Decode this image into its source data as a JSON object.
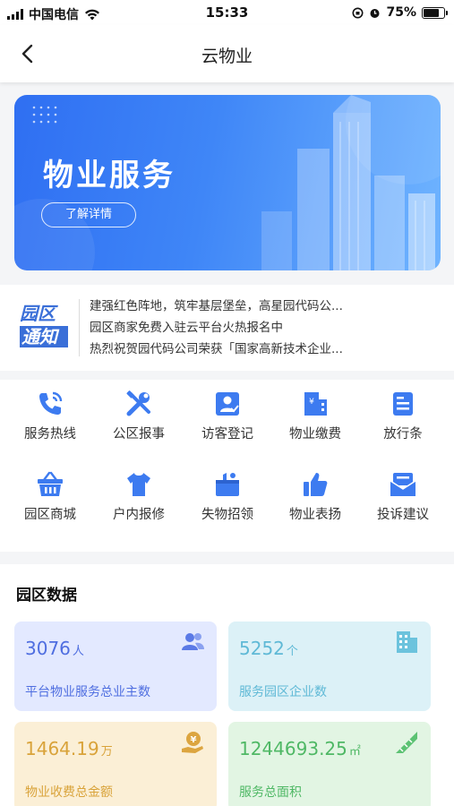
{
  "status_bar": {
    "carrier": "中国电信",
    "time": "15:33",
    "battery": "75%",
    "battery_level": 0.75
  },
  "nav": {
    "title": "云物业",
    "back_icon": "chevron-left-icon"
  },
  "banner": {
    "title": "物业服务",
    "button_label": "了解详情"
  },
  "notice": {
    "logo_line1": "园区",
    "logo_line2": "通知",
    "items": [
      "建强红色阵地，筑牢基层堡垒，高星园代码公...",
      "园区商家免费入驻云平台火热报名中",
      "热烈祝贺园代码公司荣获「国家高新技术企业..."
    ]
  },
  "services": [
    {
      "label": "服务热线",
      "icon": "phone-icon"
    },
    {
      "label": "公区报事",
      "icon": "tools-icon"
    },
    {
      "label": "访客登记",
      "icon": "visitor-icon"
    },
    {
      "label": "物业缴费",
      "icon": "building-fee-icon"
    },
    {
      "label": "放行条",
      "icon": "pass-slip-icon"
    },
    {
      "label": "园区商城",
      "icon": "basket-icon"
    },
    {
      "label": "户内报修",
      "icon": "repair-icon"
    },
    {
      "label": "失物招领",
      "icon": "lost-found-icon"
    },
    {
      "label": "物业表扬",
      "icon": "thumbs-up-icon"
    },
    {
      "label": "投诉建议",
      "icon": "mail-icon"
    }
  ],
  "park_data": {
    "title": "园区数据",
    "cards": [
      {
        "value": "3076",
        "unit": "人",
        "label": "平台物业服务总业主数",
        "icon": "users-icon",
        "bg": "#e3e9ff",
        "color": "#4f6ee0"
      },
      {
        "value": "5252",
        "unit": "个",
        "label": "服务园区企业数",
        "icon": "building-icon",
        "bg": "#dcf1f7",
        "color": "#5fb9d6"
      },
      {
        "value": "1464.19",
        "unit": "万",
        "label": "物业收费总金额",
        "icon": "yuan-hand-icon",
        "bg": "#fbefd6",
        "color": "#d9a33a"
      },
      {
        "value": "1244693.25",
        "unit": "㎡",
        "label": "服务总面积",
        "icon": "ruler-icon",
        "bg": "#e2f5e3",
        "color": "#4fb865"
      }
    ]
  }
}
